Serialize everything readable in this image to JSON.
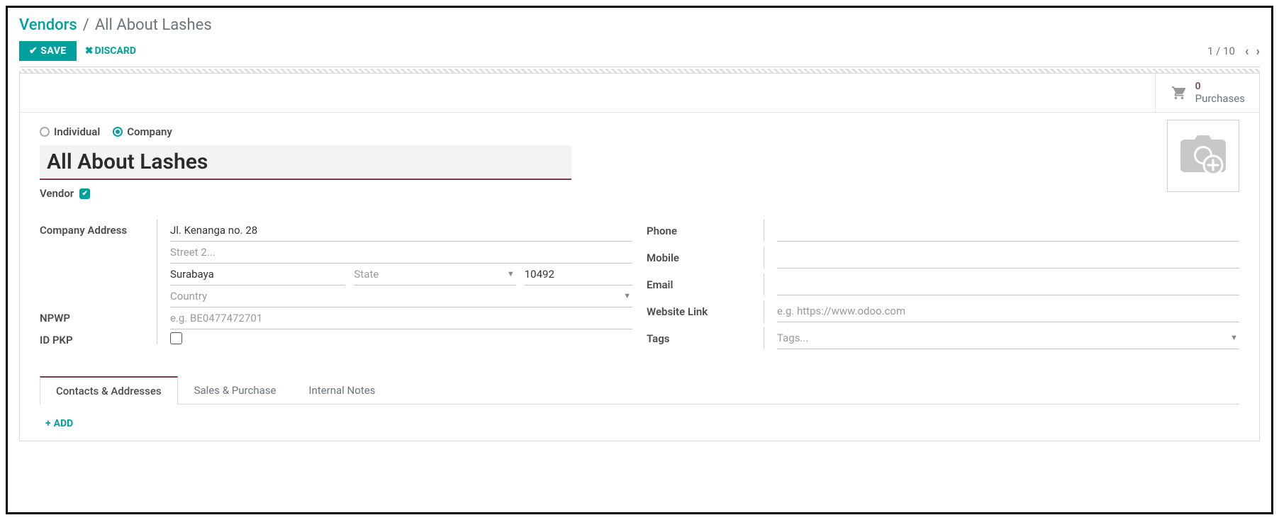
{
  "breadcrumb": {
    "root": "Vendors",
    "sep": "/",
    "current": "All About Lashes"
  },
  "toolbar": {
    "save": "SAVE",
    "discard": "DISCARD",
    "pager": "1 / 10"
  },
  "stat": {
    "purchases_count": "0",
    "purchases_label": "Purchases"
  },
  "entity": {
    "type_individual": "Individual",
    "type_company": "Company",
    "name": "All About Lashes",
    "vendor_label": "Vendor"
  },
  "left": {
    "address_label": "Company Address",
    "street": "Jl. Kenanga no. 28",
    "street2_placeholder": "Street 2...",
    "city": "Surabaya",
    "state_placeholder": "State",
    "zip": "10492",
    "country_placeholder": "Country",
    "npwp_label": "NPWP",
    "npwp_placeholder": "e.g. BE0477472701",
    "idpkp_label": "ID PKP"
  },
  "right": {
    "phone_label": "Phone",
    "mobile_label": "Mobile",
    "email_label": "Email",
    "website_label": "Website Link",
    "website_placeholder": "e.g. https://www.odoo.com",
    "tags_label": "Tags",
    "tags_placeholder": "Tags..."
  },
  "tabs": {
    "contacts": "Contacts & Addresses",
    "sales": "Sales & Purchase",
    "notes": "Internal Notes",
    "add": "ADD"
  }
}
